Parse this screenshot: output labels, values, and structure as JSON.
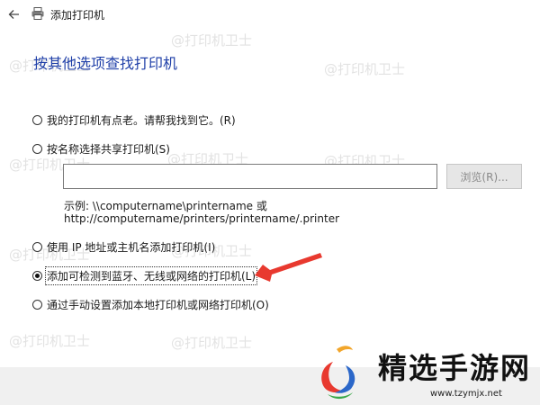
{
  "window": {
    "title": "添加打印机"
  },
  "page": {
    "title": "按其他选项查找打印机"
  },
  "options": [
    {
      "label": "我的打印机有点老。请帮我找到它。(R)",
      "checked": false
    },
    {
      "label": "按名称选择共享打印机(S)",
      "checked": false
    },
    {
      "label": "使用 IP 地址或主机名添加打印机(I)",
      "checked": false
    },
    {
      "label": "添加可检测到蓝牙、无线或网络的打印机(L)",
      "checked": true
    },
    {
      "label": "通过手动设置添加本地打印机或网络打印机(O)",
      "checked": false
    }
  ],
  "shared": {
    "input_value": "",
    "browse_label": "浏览(R)...",
    "example_line1": "示例: \\\\computername\\printername 或",
    "example_line2": "http://computername/printers/printername/.printer"
  },
  "watermark": {
    "text": "@打印机卫士"
  },
  "brand": {
    "name": "精选手游网",
    "url": "www.tzymjx.net"
  },
  "colors": {
    "title_blue": "#1f3fa8",
    "arrow_red": "#e8392f",
    "footer_gray": "#f0f0f0"
  },
  "icons": {
    "back": "back-arrow-icon",
    "printer": "printer-icon"
  }
}
